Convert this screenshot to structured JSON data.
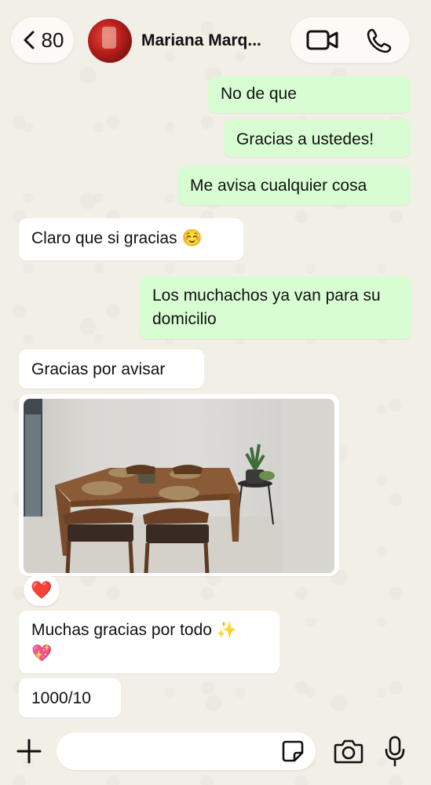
{
  "header": {
    "back_count": "80",
    "contact_name": "Mariana Marq..."
  },
  "messages": [
    {
      "direction": "out",
      "text": "No de que"
    },
    {
      "direction": "out",
      "text": "Gracias a ustedes!"
    },
    {
      "direction": "out",
      "text": "Me avisa cualquier cosa"
    },
    {
      "direction": "in",
      "text": "Claro que si gracias",
      "emoji": "☺️"
    },
    {
      "direction": "out",
      "text": "Los muchachos ya van para su domicilio"
    },
    {
      "direction": "in",
      "text": "Gracias por avisar"
    },
    {
      "direction": "in",
      "type": "image",
      "reaction": "❤️"
    },
    {
      "direction": "in",
      "text": "Muchas gracias por todo",
      "emoji": "✨",
      "emoji2": "💖"
    },
    {
      "direction": "in",
      "text": "1000/10"
    }
  ],
  "input": {
    "placeholder": ""
  },
  "colors": {
    "outgoing_bubble": "#d9fdd3",
    "incoming_bubble": "#ffffff",
    "background": "#f2efe7"
  },
  "icons": [
    "chevron-left-icon",
    "video-call-icon",
    "phone-icon",
    "plus-icon",
    "sticker-icon",
    "camera-icon",
    "microphone-icon"
  ]
}
